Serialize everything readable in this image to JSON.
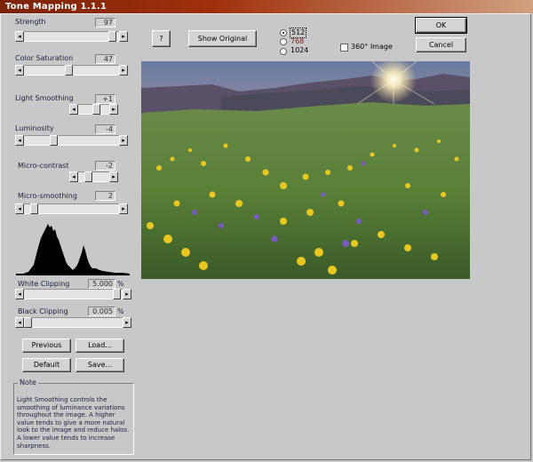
{
  "window": {
    "title": "Tone Mapping 1.1.1"
  },
  "controls": [
    {
      "id": "strength",
      "label": "Strength",
      "value": "97",
      "level": 0.97
    },
    {
      "id": "color_saturation",
      "label": "Color Saturation",
      "value": "47",
      "level": 0.47
    },
    {
      "id": "light_smoothing",
      "label": "Light Smoothing",
      "value": "+1",
      "level": 0.6
    },
    {
      "id": "luminosity",
      "label": "Luminosity",
      "value": "-4",
      "level": 0.3
    },
    {
      "id": "micro_contrast",
      "label": "Micro-contrast",
      "value": "-2",
      "level": 0.25
    },
    {
      "id": "micro_smoothing",
      "label": "Micro-smoothing",
      "value": "2",
      "level": 0.07
    },
    {
      "id": "white_clipping",
      "label": "White Clipping",
      "value": "5.000",
      "unit": "%",
      "level": 0.98
    },
    {
      "id": "black_clipping",
      "label": "Black Clipping",
      "value": "0.005",
      "unit": "%",
      "level": 0.0
    }
  ],
  "buttons": {
    "help": "?",
    "show_original": "Show Original",
    "ok": "OK",
    "cancel": "Cancel",
    "previous": "Previous",
    "load": "Load...",
    "default": "Default",
    "save": "Save..."
  },
  "preview_size": {
    "options": [
      "512",
      "768",
      "1024"
    ],
    "selected": "512"
  },
  "image_360": {
    "label": "360° Image",
    "checked": false
  },
  "note": {
    "title": "Note",
    "text": "Light Smoothing controls the smoothing of luminance variations throughout the image. A higher value tends to give a more natural look to the image and reduce halos. A lower value tends to increase sharpness."
  },
  "colors": {
    "titlebar": "#9a2c0a",
    "window": "#c8c8c8",
    "selected_option": "#7a2020"
  },
  "icons": {
    "slider_left": "arrow-left-icon",
    "slider_right": "arrow-right-icon"
  }
}
